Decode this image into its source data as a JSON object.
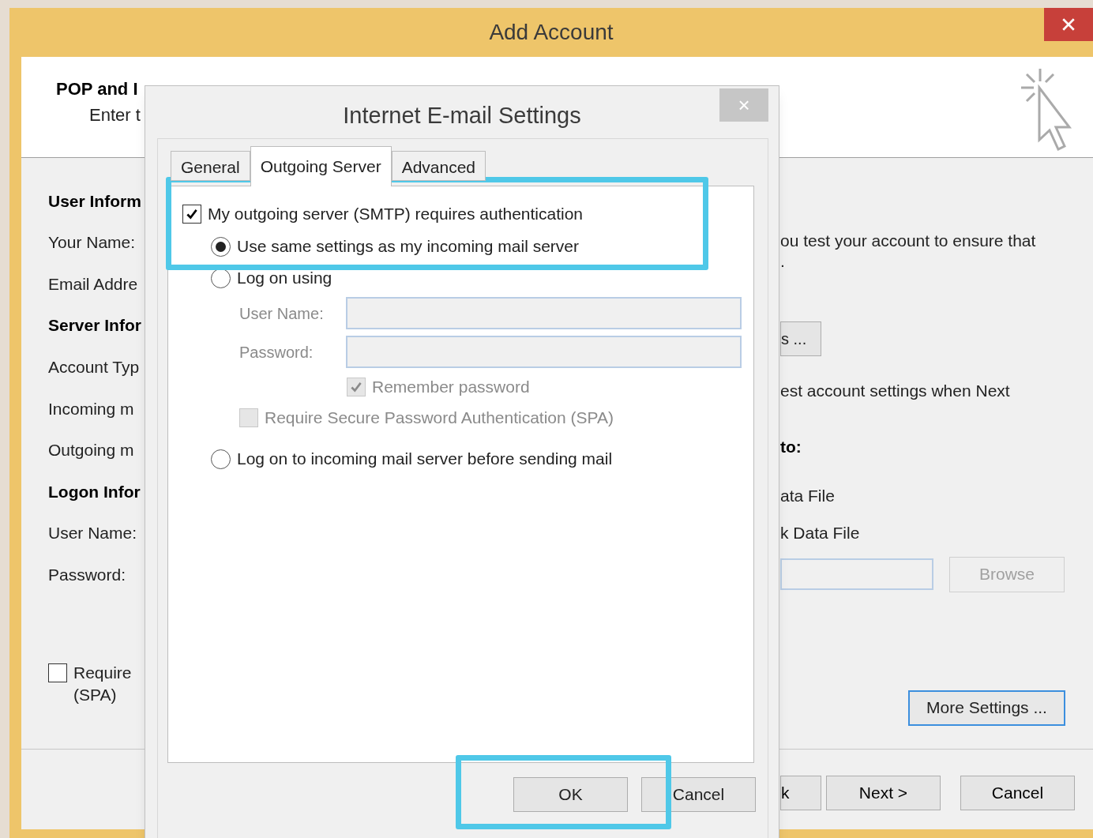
{
  "window": {
    "title": "Add Account"
  },
  "header": {
    "title": "POP and I",
    "subtitle": "Enter t"
  },
  "left_form": [
    {
      "kind": "heading",
      "text": "User Inform"
    },
    {
      "kind": "label",
      "text": "Your Name:"
    },
    {
      "kind": "label",
      "text": "Email Addre"
    },
    {
      "kind": "heading",
      "text": "Server Infor"
    },
    {
      "kind": "label",
      "text": "Account Typ"
    },
    {
      "kind": "label",
      "text": "Incoming m"
    },
    {
      "kind": "label",
      "text": "Outgoing m"
    },
    {
      "kind": "heading",
      "text": "Logon Infor"
    },
    {
      "kind": "label",
      "text": "User Name:"
    },
    {
      "kind": "label",
      "text": "Password:"
    }
  ],
  "spa_checkbox": {
    "label": "Require",
    "label_line2": "(SPA)",
    "checked": false
  },
  "right_panel": {
    "test_text": "ou test your account to ensure that",
    "test_text_line2": ".",
    "test_button": "s ...",
    "test_option": "est account settings when Next",
    "deliver_heading": "to:",
    "deliver_options": [
      "ata File",
      "k Data File"
    ],
    "browse_button": {
      "label": "Browse",
      "disabled": true
    },
    "more_button": "More Settings ..."
  },
  "footer_buttons": [
    "k",
    "Next >",
    "Cancel"
  ],
  "dialog": {
    "title": "Internet E-mail Settings",
    "close": "×",
    "tabs": [
      {
        "label": "General",
        "selected": false
      },
      {
        "label": "Outgoing Server",
        "selected": true
      },
      {
        "label": "Advanced",
        "selected": false
      }
    ],
    "auth_checkbox": {
      "label": "My outgoing server (SMTP) requires authentication",
      "checked": true
    },
    "radios": [
      {
        "label": "Use same settings as my incoming mail server",
        "selected": true
      },
      {
        "label": "Log on using",
        "selected": false,
        "children": [
          {
            "kind": "field",
            "label": "User Name:",
            "disabled": true
          },
          {
            "kind": "field",
            "label": "Password:",
            "disabled": true
          },
          {
            "kind": "field_check",
            "label": "Remember password",
            "checked": true,
            "disabled": true
          },
          {
            "kind": "check",
            "label": "Require Secure Password Authentication (SPA)",
            "checked": false,
            "disabled": true
          }
        ]
      },
      {
        "label": "Log on to incoming mail server before sending mail",
        "selected": false
      }
    ],
    "buttons": [
      "OK",
      "Cancel"
    ]
  }
}
